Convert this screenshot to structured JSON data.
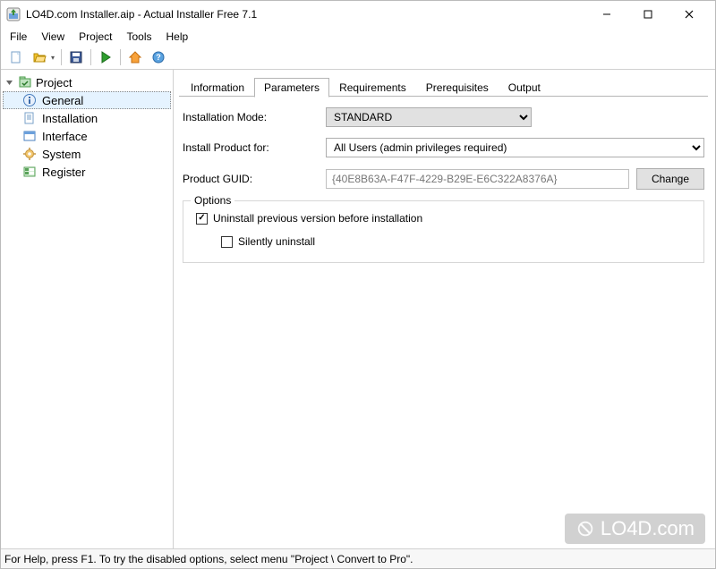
{
  "window": {
    "title": "LO4D.com Installer.aip - Actual Installer Free 7.1"
  },
  "menu": {
    "items": [
      "File",
      "View",
      "Project",
      "Tools",
      "Help"
    ]
  },
  "sidebar": {
    "root": "Project",
    "items": [
      {
        "label": "General"
      },
      {
        "label": "Installation"
      },
      {
        "label": "Interface"
      },
      {
        "label": "System"
      },
      {
        "label": "Register"
      }
    ]
  },
  "tabs": {
    "items": [
      "Information",
      "Parameters",
      "Requirements",
      "Prerequisites",
      "Output"
    ],
    "active_index": 1
  },
  "form": {
    "mode_label": "Installation Mode:",
    "mode_value": "STANDARD",
    "for_label": "Install Product for:",
    "for_value": "All Users (admin privileges required)",
    "guid_label": "Product GUID:",
    "guid_value": "{40E8B63A-F47F-4229-B29E-E6C322A8376A}",
    "change_btn": "Change",
    "options_legend": "Options",
    "opt_uninstall": "Uninstall previous version before installation",
    "opt_silent": "Silently uninstall"
  },
  "status": {
    "text": "For Help, press F1.  To try the disabled options, select menu \"Project \\ Convert to Pro\"."
  },
  "watermark": {
    "text": "LO4D.com"
  }
}
